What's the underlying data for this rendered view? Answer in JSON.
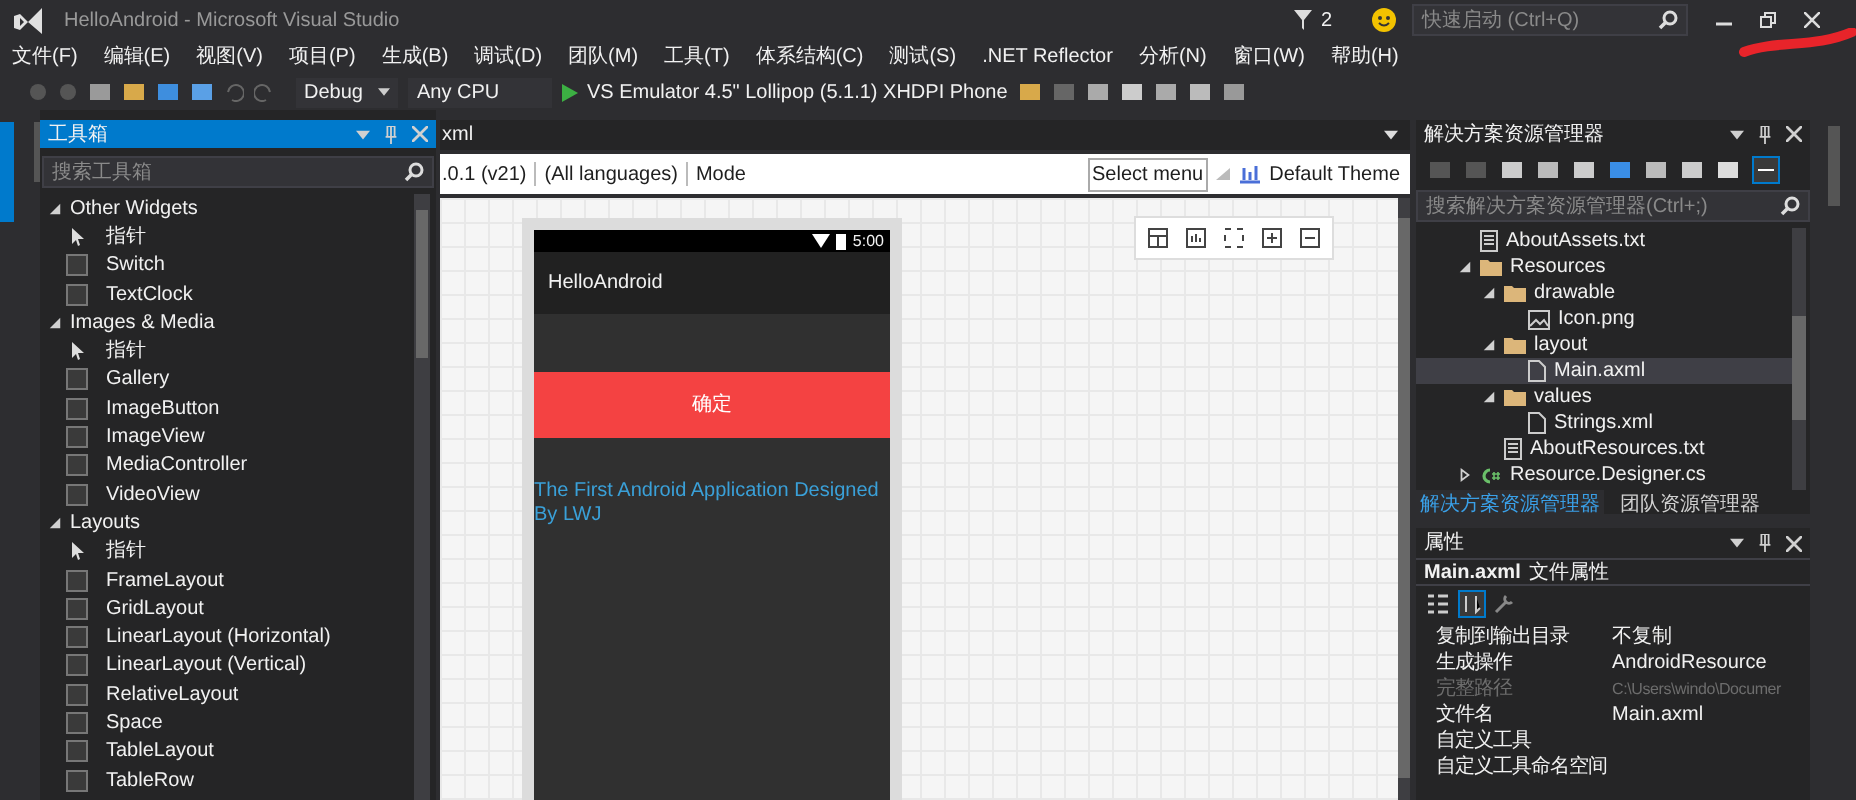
{
  "window": {
    "title": "HelloAndroid - Microsoft Visual Studio",
    "notifications": "2",
    "quick_launch": {
      "placeholder": "快速启动 (Ctrl+Q)"
    }
  },
  "left_dock_tabs": [
    {
      "selected": true
    },
    {
      "selected": false
    }
  ],
  "menu": [
    "文件(F)",
    "编辑(E)",
    "视图(V)",
    "项目(P)",
    "生成(B)",
    "调试(D)",
    "团队(M)",
    "工具(T)",
    "体系结构(C)",
    "测试(S)",
    ".NET Reflector",
    "分析(N)",
    "窗口(W)",
    "帮助(H)"
  ],
  "toolbar": {
    "configuration": "Debug",
    "platform": "Any CPU",
    "run_target": "VS Emulator 4.5\" Lollipop (5.1.1) XHDPI Phone"
  },
  "toolbox": {
    "title": "工具箱",
    "search": {
      "placeholder": "搜索工具箱"
    },
    "groups": [
      {
        "label": "Other Widgets",
        "expanded": true,
        "items": [
          {
            "label": "指针",
            "kind": "pointer"
          },
          {
            "label": "Switch",
            "kind": "control"
          },
          {
            "label": "TextClock",
            "kind": "control"
          }
        ]
      },
      {
        "label": "Images & Media",
        "expanded": true,
        "items": [
          {
            "label": "指针",
            "kind": "pointer"
          },
          {
            "label": "Gallery",
            "kind": "control"
          },
          {
            "label": "ImageButton",
            "kind": "control"
          },
          {
            "label": "ImageView",
            "kind": "control"
          },
          {
            "label": "MediaController",
            "kind": "control"
          },
          {
            "label": "VideoView",
            "kind": "control"
          }
        ]
      },
      {
        "label": "Layouts",
        "expanded": true,
        "items": [
          {
            "label": "指针",
            "kind": "pointer"
          },
          {
            "label": "FrameLayout",
            "kind": "control"
          },
          {
            "label": "GridLayout",
            "kind": "control"
          },
          {
            "label": "LinearLayout (Horizontal)",
            "kind": "control"
          },
          {
            "label": "LinearLayout (Vertical)",
            "kind": "control"
          },
          {
            "label": "RelativeLayout",
            "kind": "control"
          },
          {
            "label": "Space",
            "kind": "control"
          },
          {
            "label": "TableLayout",
            "kind": "control"
          },
          {
            "label": "TableRow",
            "kind": "control"
          }
        ]
      }
    ]
  },
  "designer": {
    "tab": "xml",
    "api": ".0.1 (v21)",
    "language": "(All languages)",
    "mode": "Mode",
    "select_menu": "Select menu",
    "theme": "Default Theme",
    "phone": {
      "time": "5:00",
      "app_title": "HelloAndroid",
      "button": "确定",
      "text": "The First Android Application Designed By LWJ"
    }
  },
  "solution_explorer": {
    "title": "解决方案资源管理器",
    "search": {
      "placeholder": "搜索解决方案资源管理器(Ctrl+;)"
    },
    "tree": [
      {
        "label": "AboutAssets.txt",
        "kind": "text",
        "selected": false
      },
      {
        "label": "Resources",
        "kind": "folder",
        "expanded": true,
        "selected": false,
        "children": [
          {
            "label": "drawable",
            "kind": "folder",
            "expanded": true,
            "selected": false,
            "children": [
              {
                "label": "Icon.png",
                "kind": "image",
                "selected": false
              }
            ]
          },
          {
            "label": "layout",
            "kind": "folder",
            "expanded": true,
            "selected": false,
            "children": [
              {
                "label": "Main.axml",
                "kind": "file",
                "selected": true
              }
            ]
          },
          {
            "label": "values",
            "kind": "folder",
            "expanded": true,
            "selected": false,
            "children": [
              {
                "label": "Strings.xml",
                "kind": "file",
                "selected": false
              }
            ]
          },
          {
            "label": "AboutResources.txt",
            "kind": "text",
            "selected": false
          }
        ]
      },
      {
        "label": "Resource.Designer.cs",
        "kind": "csharp",
        "expanded": false,
        "selected": false
      }
    ],
    "tabs": [
      {
        "label": "解决方案资源管理器",
        "selected": true
      },
      {
        "label": "团队资源管理器",
        "selected": false
      }
    ]
  },
  "properties": {
    "title": "属性",
    "object": "Main.axml",
    "object_type": "文件属性",
    "rows": [
      {
        "name": "复制到输出目录",
        "value": "不复制",
        "disabled": false
      },
      {
        "name": "生成操作",
        "value": "AndroidResource",
        "disabled": false
      },
      {
        "name": "完整路径",
        "value": "C:\\Users\\windo\\Documer",
        "disabled": true
      },
      {
        "name": "文件名",
        "value": "Main.axml",
        "disabled": false
      },
      {
        "name": "自定义工具",
        "value": "",
        "disabled": false
      },
      {
        "name": "自定义工具命名空间",
        "value": "",
        "disabled": false
      }
    ]
  }
}
